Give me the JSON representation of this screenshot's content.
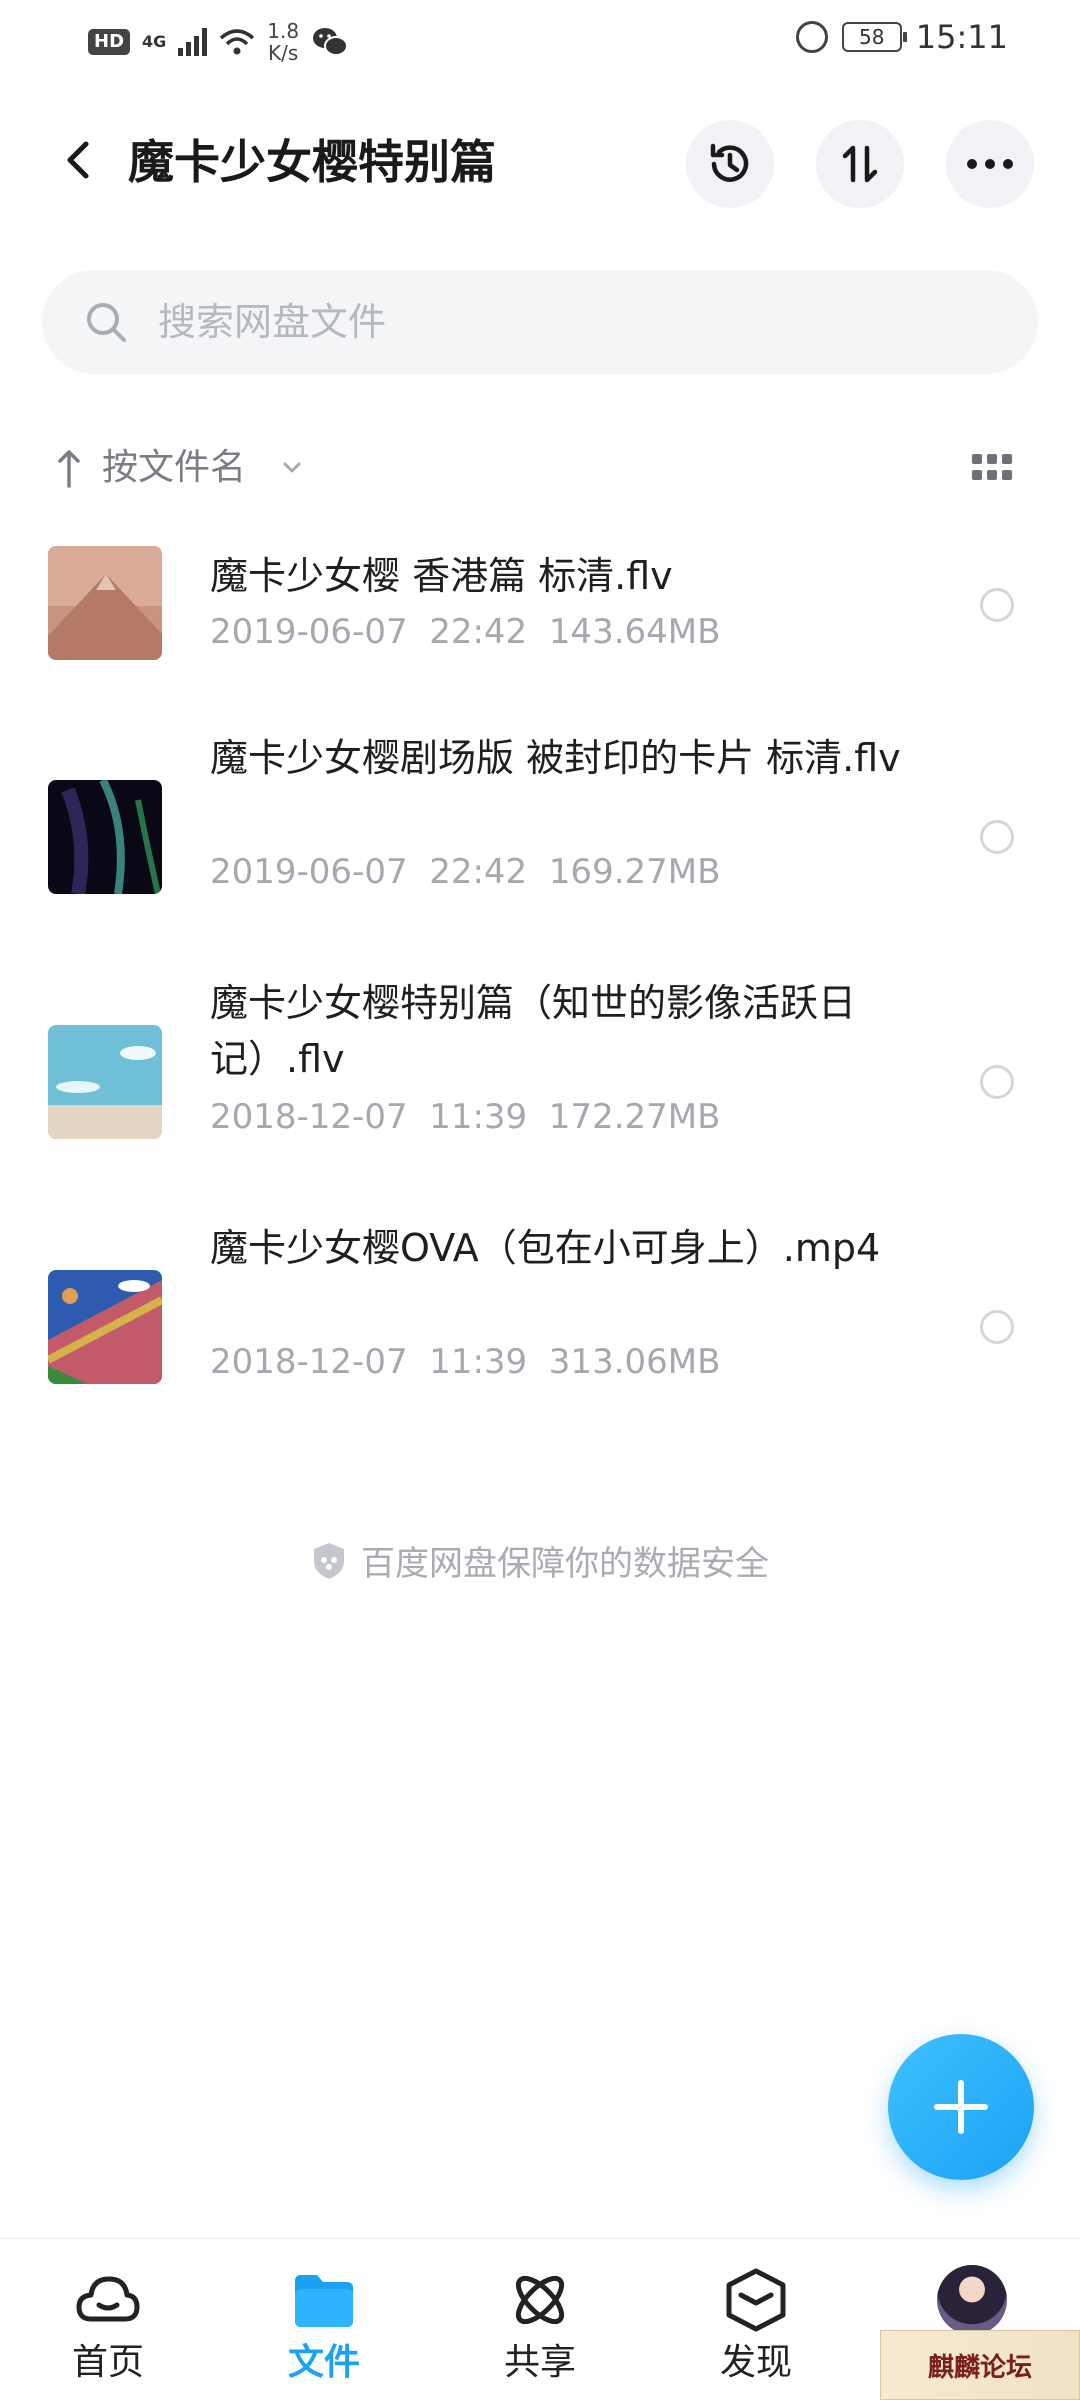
{
  "status_bar": {
    "hd": "HD",
    "network": "4G",
    "speed_value": "1.8",
    "speed_unit": "K/s",
    "battery": "58",
    "time": "15:11"
  },
  "header": {
    "title": "魔卡少女樱特别篇",
    "icons": [
      "back-arrow",
      "history",
      "sort-toggle",
      "more"
    ]
  },
  "search": {
    "placeholder": "搜索网盘文件"
  },
  "sort": {
    "label": "按文件名"
  },
  "files": [
    {
      "name": "魔卡少女樱 香港篇 标清.flv",
      "meta": "2019-06-07  22:42  143.64MB",
      "thumb": "mountain"
    },
    {
      "name": "魔卡少女樱剧场版 被封印的卡片 标清.flv",
      "meta": "2019-06-07  22:42  169.27MB",
      "thumb": "aurora"
    },
    {
      "name": "魔卡少女樱特别篇（知世的影像活跃日记）.flv",
      "meta": "2018-12-07  11:39  172.27MB",
      "thumb": "sky"
    },
    {
      "name": "魔卡少女樱OVA（包在小可身上）.mp4",
      "meta": "2018-12-07  11:39  313.06MB",
      "thumb": "cartoon"
    }
  ],
  "safety_note": "百度网盘保障你的数据安全",
  "bottom_nav": [
    {
      "label": "首页",
      "icon": "cloud-icon",
      "active": false
    },
    {
      "label": "文件",
      "icon": "folder-icon",
      "active": true
    },
    {
      "label": "共享",
      "icon": "atom-icon",
      "active": false
    },
    {
      "label": "发现",
      "icon": "cube-icon",
      "active": false
    },
    {
      "label": "",
      "icon": "avatar",
      "active": false
    }
  ],
  "watermark": "麒麟论坛",
  "colors": {
    "accent": "#1aa2f4",
    "muted_text": "#a5a8ae",
    "search_bg": "#f4f5f7"
  }
}
